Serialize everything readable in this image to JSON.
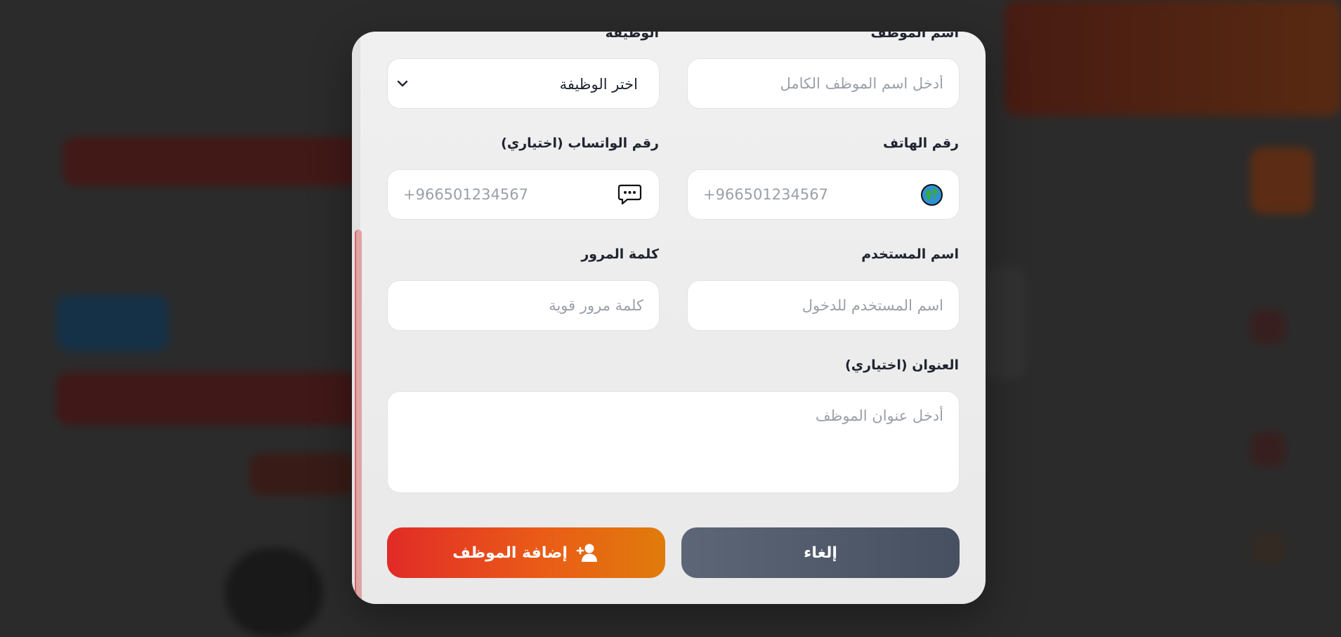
{
  "form": {
    "employee_name": {
      "label": "اسم الموظف",
      "placeholder": "أدخل اسم الموظف الكامل"
    },
    "job": {
      "label": "الوظيفة",
      "selected": "اختر الوظيفة"
    },
    "phone": {
      "label": "رقم الهاتف",
      "placeholder": "+966501234567",
      "icon": "globe-icon"
    },
    "whatsapp": {
      "label": "رقم الواتساب (اختياري)",
      "placeholder": "+966501234567",
      "icon": "chat-icon"
    },
    "username": {
      "label": "اسم المستخدم",
      "placeholder": "اسم المستخدم للدخول"
    },
    "password": {
      "label": "كلمة المرور",
      "placeholder": "كلمة مرور قوية"
    },
    "address": {
      "label": "العنوان (اختياري)",
      "placeholder": "أدخل عنوان الموظف"
    }
  },
  "actions": {
    "cancel_label": "إلغاء",
    "add_label": "إضافة الموظف",
    "add_icon": "user-plus-icon"
  },
  "colors": {
    "accent_start": "#e12b27",
    "accent_end": "#e07c0b",
    "cancel": "#505a6a"
  }
}
